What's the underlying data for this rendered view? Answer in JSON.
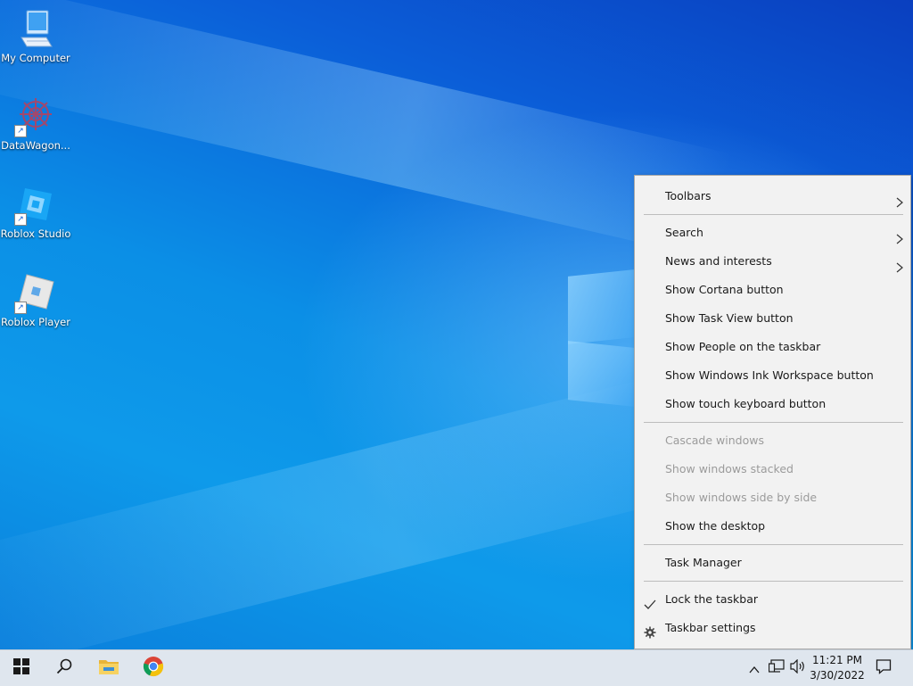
{
  "desktop": {
    "icons": [
      {
        "label": "My Computer",
        "icon": "computer-icon"
      },
      {
        "label": "DataWagon...",
        "icon": "datawagon-icon"
      },
      {
        "label": "Roblox Studio",
        "icon": "roblox-studio-icon"
      },
      {
        "label": "Roblox Player",
        "icon": "roblox-player-icon"
      }
    ]
  },
  "context_menu": {
    "toolbars": "Toolbars",
    "search": "Search",
    "news": "News and interests",
    "cortana": "Show Cortana button",
    "task_view": "Show Task View button",
    "people": "Show People on the taskbar",
    "ink": "Show Windows Ink Workspace button",
    "touch_keyboard": "Show touch keyboard button",
    "cascade": "Cascade windows",
    "stacked": "Show windows stacked",
    "side_by_side": "Show windows side by side",
    "show_desktop": "Show the desktop",
    "task_manager": "Task Manager",
    "lock": "Lock the taskbar",
    "settings": "Taskbar settings"
  },
  "taskbar": {
    "pinned": [
      "start-icon",
      "search-icon",
      "file-explorer-icon",
      "chrome-icon"
    ],
    "clock": {
      "time": "11:21 PM",
      "date": "3/30/2022"
    }
  },
  "colors": {
    "menu_bg": "#f2f2f2",
    "disabled_text": "#9b9b9b",
    "taskbar_bg": "#dfe6ee",
    "desktop_accent": "#0b8fe6"
  }
}
